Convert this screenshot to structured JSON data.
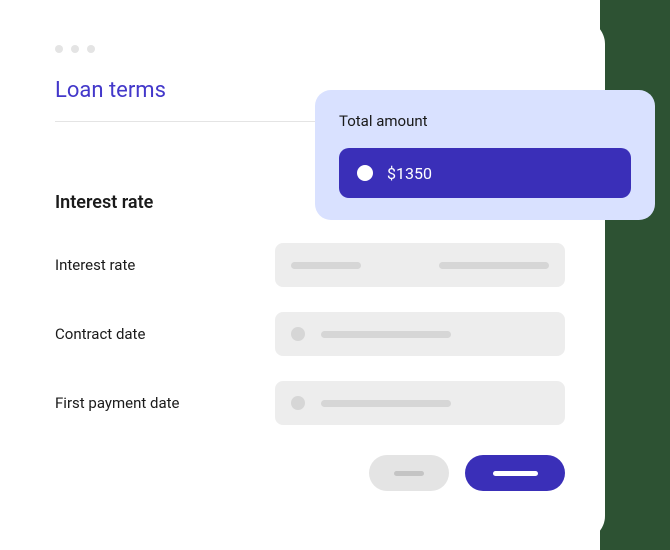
{
  "header": {
    "title": "Loan terms"
  },
  "summary": {
    "label": "Total amount",
    "amount": "$1350"
  },
  "section": {
    "heading": "Interest rate"
  },
  "fields": {
    "interest_rate_label": "Interest rate",
    "contract_date_label": "Contract date",
    "first_payment_date_label": "First payment date"
  }
}
